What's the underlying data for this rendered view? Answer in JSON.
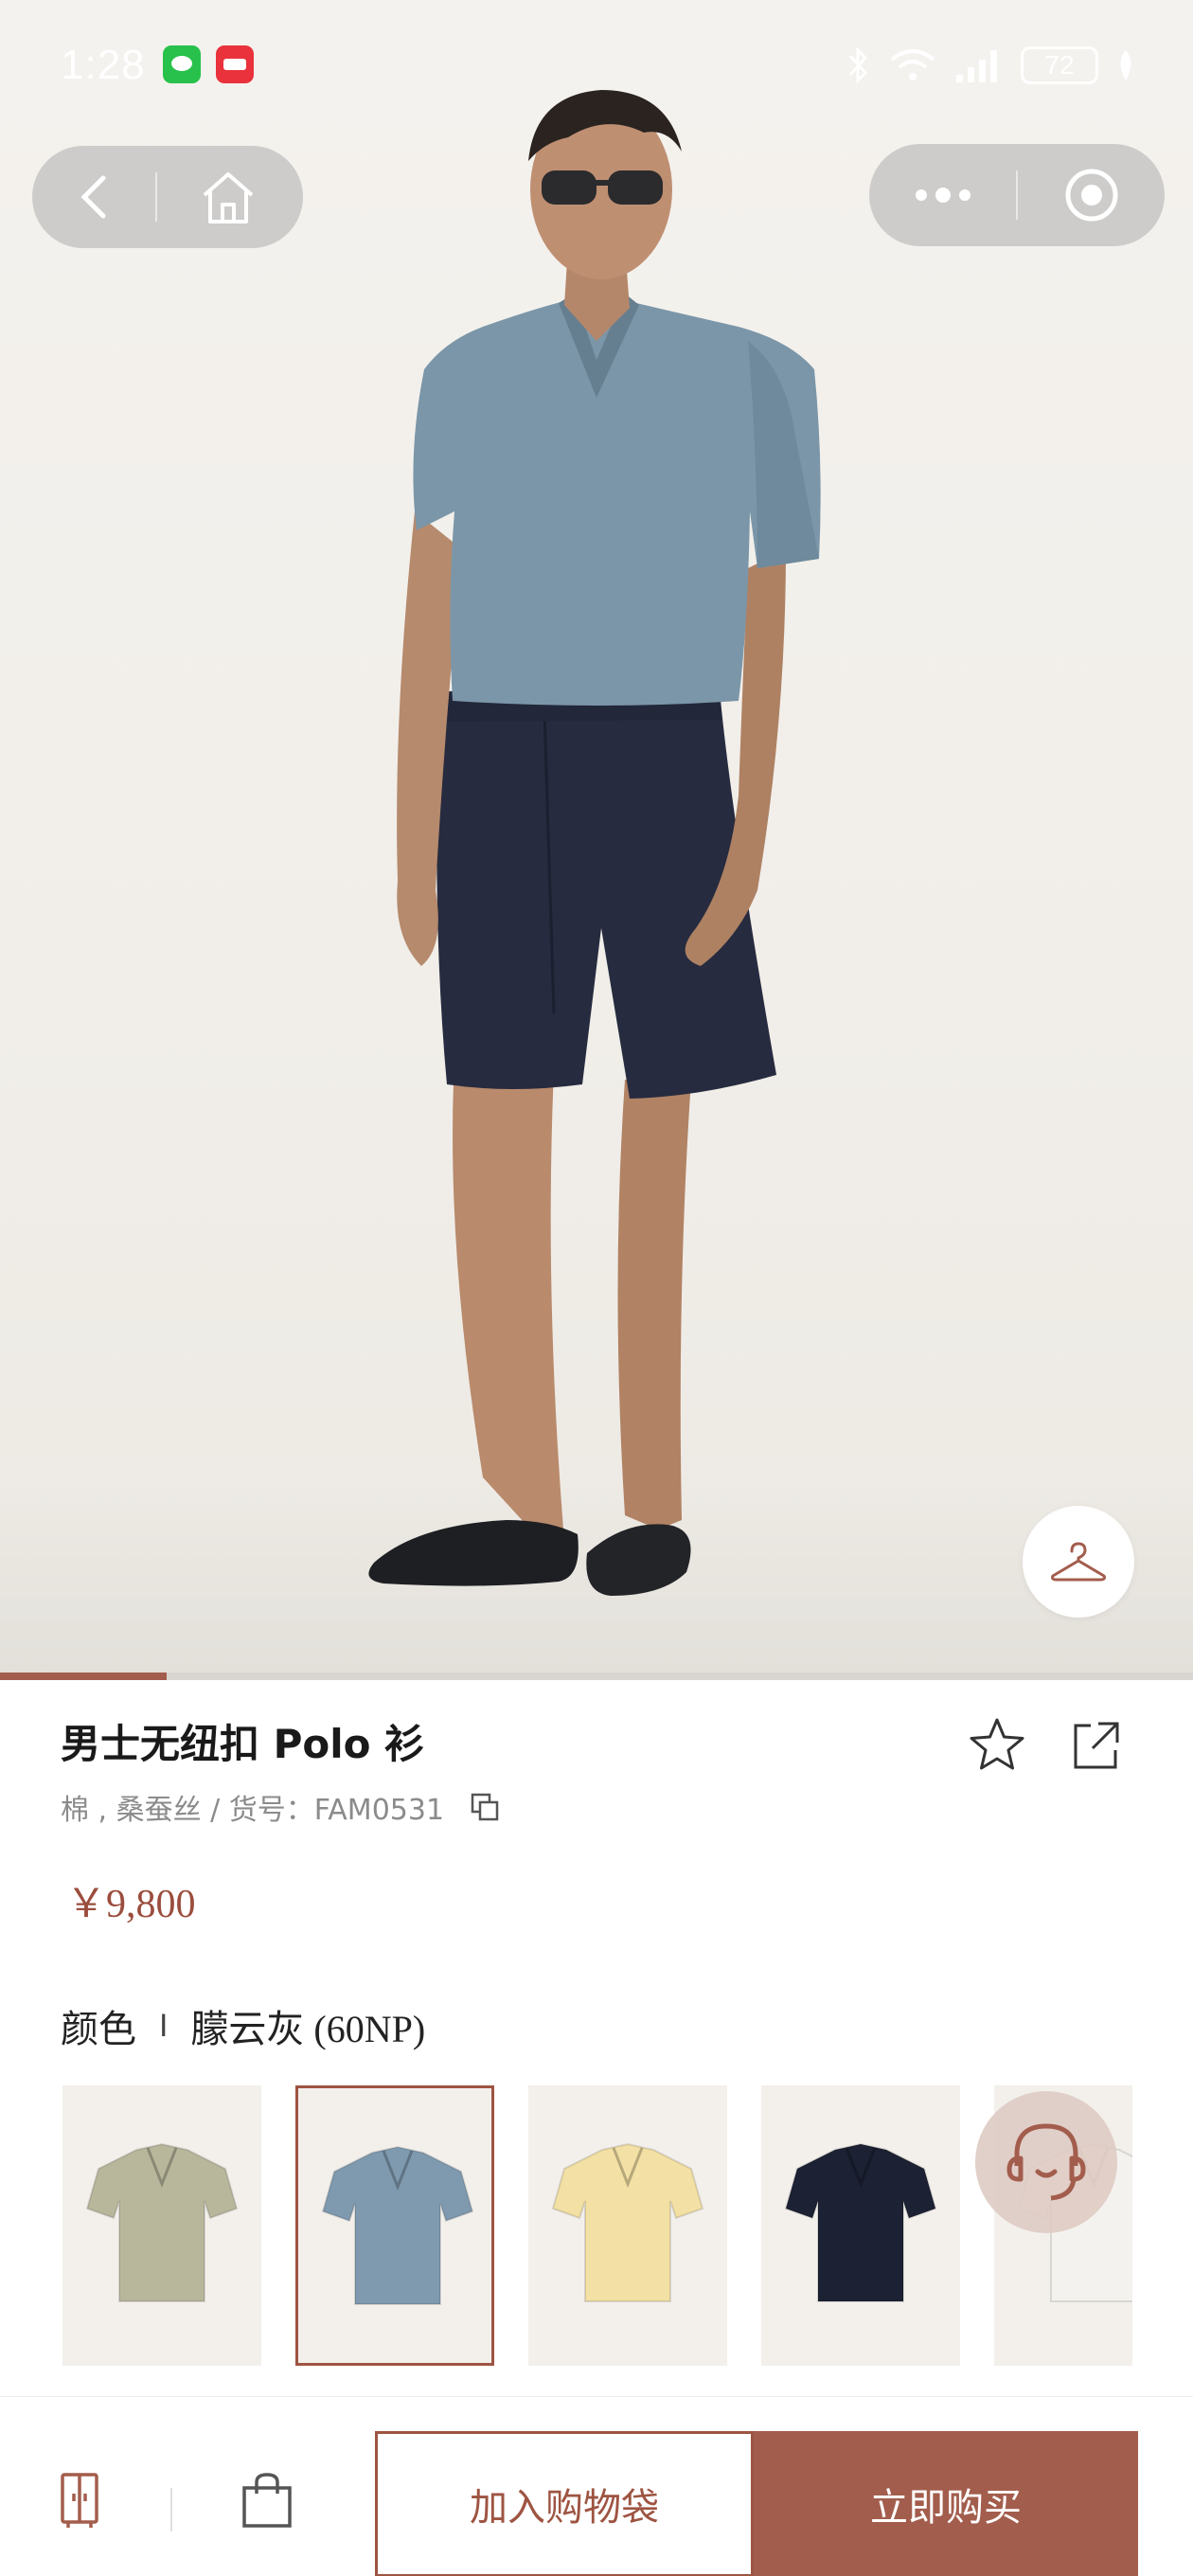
{
  "status_bar": {
    "time": "1:28",
    "battery": "72",
    "icons": [
      "wechat-icon",
      "xiaohongshu-icon",
      "bluetooth-icon",
      "wifi-icon",
      "signal-icon",
      "battery-icon",
      "leaf-icon"
    ]
  },
  "nav": {
    "left_icons": [
      "back-icon",
      "home-icon"
    ],
    "right_icons": [
      "more-icon",
      "close-miniprogram-icon"
    ]
  },
  "gallery": {
    "progress": 0.14,
    "colors": {
      "accent": "#a35d4d"
    }
  },
  "product": {
    "title": "男士无纽扣 Polo 衫",
    "meta": "棉 , 桑蚕丝 / 货号：FAM0531",
    "price": "￥9,800"
  },
  "color_selector": {
    "label": "颜色",
    "separator": "I",
    "selected_name": "朦云灰 (60NP)",
    "swatches": [
      {
        "color": "#b8b79c",
        "selected": false
      },
      {
        "color": "#7f9aaf",
        "selected": true
      },
      {
        "color": "#f3e0a4",
        "selected": false
      },
      {
        "color": "#1c2133",
        "selected": false
      },
      {
        "color": "#f4f2ee",
        "selected": false
      }
    ]
  },
  "bottom_bar": {
    "add_to_bag": "加入购物袋",
    "buy_now": "立即购买",
    "icons": [
      "wardrobe-icon",
      "shopping-bag-icon"
    ]
  }
}
